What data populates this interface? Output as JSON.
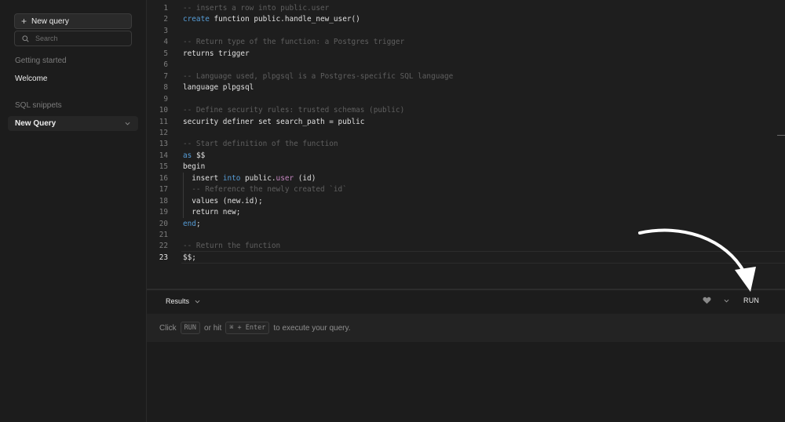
{
  "sidebar": {
    "new_query_label": "New query",
    "search_placeholder": "Search",
    "getting_started_heading": "Getting started",
    "welcome_label": "Welcome",
    "sql_snippets_heading": "SQL snippets",
    "active_query_label": "New Query"
  },
  "editor": {
    "lines": [
      {
        "n": "1",
        "parts": [
          {
            "t": "-- inserts a row into public.user",
            "c": "c"
          }
        ]
      },
      {
        "n": "2",
        "parts": [
          {
            "t": "create",
            "c": "k"
          },
          {
            "t": " function public.handle_new_user()",
            "c": ""
          }
        ]
      },
      {
        "n": "3",
        "parts": []
      },
      {
        "n": "4",
        "parts": [
          {
            "t": "-- Return type of the function: a Postgres trigger",
            "c": "c"
          }
        ]
      },
      {
        "n": "5",
        "parts": [
          {
            "t": "returns trigger",
            "c": ""
          }
        ]
      },
      {
        "n": "6",
        "parts": []
      },
      {
        "n": "7",
        "parts": [
          {
            "t": "-- Language used, plpgsql is a Postgres-specific SQL language",
            "c": "c"
          }
        ]
      },
      {
        "n": "8",
        "parts": [
          {
            "t": "language plpgsql",
            "c": ""
          }
        ]
      },
      {
        "n": "9",
        "parts": []
      },
      {
        "n": "10",
        "parts": [
          {
            "t": "-- Define security rules: trusted schemas (public)",
            "c": "c"
          }
        ]
      },
      {
        "n": "11",
        "parts": [
          {
            "t": "security definer set search_path = public",
            "c": ""
          }
        ]
      },
      {
        "n": "12",
        "parts": []
      },
      {
        "n": "13",
        "parts": [
          {
            "t": "-- Start definition of the function",
            "c": "c"
          }
        ]
      },
      {
        "n": "14",
        "parts": [
          {
            "t": "as",
            "c": "k"
          },
          {
            "t": " $$",
            "c": ""
          }
        ]
      },
      {
        "n": "15",
        "parts": [
          {
            "t": "begin",
            "c": ""
          }
        ]
      },
      {
        "n": "16",
        "parts": [
          {
            "t": "  insert ",
            "c": ""
          },
          {
            "t": "into",
            "c": "k"
          },
          {
            "t": " public.",
            "c": ""
          },
          {
            "t": "user",
            "c": "m"
          },
          {
            "t": " (id)",
            "c": ""
          }
        ]
      },
      {
        "n": "17",
        "parts": [
          {
            "t": "  -- Reference the newly created `id`",
            "c": "c"
          }
        ]
      },
      {
        "n": "18",
        "parts": [
          {
            "t": "  values (new.id);",
            "c": ""
          }
        ]
      },
      {
        "n": "19",
        "parts": [
          {
            "t": "  return new;",
            "c": ""
          }
        ]
      },
      {
        "n": "20",
        "parts": [
          {
            "t": "end",
            "c": "k"
          },
          {
            "t": ";",
            "c": ""
          }
        ]
      },
      {
        "n": "21",
        "parts": []
      },
      {
        "n": "22",
        "parts": [
          {
            "t": "-- Return the function",
            "c": "c"
          }
        ]
      },
      {
        "n": "23",
        "parts": [
          {
            "t": "$$;",
            "c": ""
          }
        ]
      }
    ],
    "current_line": "23"
  },
  "results": {
    "tab_label": "Results",
    "run_label": "RUN",
    "hint_click": "Click",
    "hint_run_key": "RUN",
    "hint_or_hit": "or hit",
    "hint_shortcut": "⌘ + Enter",
    "hint_suffix": "to execute your query."
  },
  "icons": {
    "new_query": "plus-icon",
    "search": "search-icon",
    "active_query": "chevron-down-icon",
    "results_tab": "chevron-down-icon",
    "favorite": "heart-icon",
    "run_options": "chevron-down-icon",
    "annotation": "curved-arrow-icon"
  },
  "colors": {
    "background": "#1c1c1c",
    "editor_background": "#1e1e1e",
    "keyword": "#569cd6",
    "table_name": "#c586c0",
    "comment": "#5f5f5f"
  }
}
